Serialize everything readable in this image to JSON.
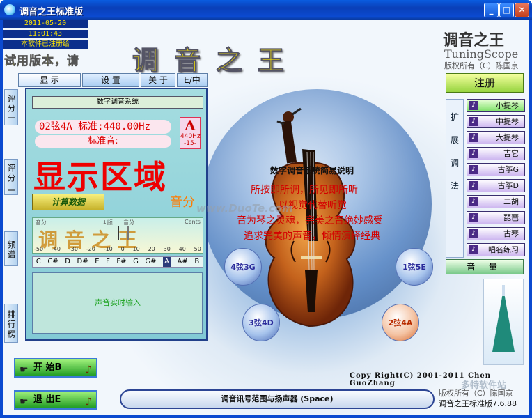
{
  "window": {
    "title": "调音之王标准版",
    "btn_min": "_",
    "btn_max": "□",
    "btn_close": "✕"
  },
  "info": {
    "date": "2011-05-20",
    "time": "11:01:43",
    "registered": "本软件已注册给",
    "trial": "试用版本，请"
  },
  "header": {
    "big_title": "调音之王",
    "logo_cn": "调音之王",
    "logo_en": "TuningScope",
    "logo_copy": "版权所有（C）陈国京"
  },
  "tabs": [
    "显 示",
    "设 置",
    "关 于",
    "E/中"
  ],
  "side_tabs": [
    "评分一",
    "评分二",
    "频谱",
    "排行榜"
  ],
  "panel": {
    "system_name": "数字调音系统",
    "string_info": "02弦4A 标准:440.00Hz",
    "standard_tone": "标准音:",
    "note": "A",
    "note_hz": "440Hz",
    "note_cents": "-15-",
    "display_area": "显示区域",
    "score_label": "音分",
    "calc_button": "计算数据",
    "meter_left": "音分",
    "meter_mid": "↓频",
    "meter_mid2": "音分",
    "meter_right": "Cents",
    "meter_watermark": "调音之王",
    "scale": [
      "-50",
      "-40",
      "-30",
      "-20",
      "-10",
      "0",
      "10",
      "20",
      "30",
      "40",
      "50"
    ],
    "keys": [
      "C",
      "C#",
      "D",
      "D#",
      "E",
      "F",
      "F#",
      "G",
      "G#",
      "A",
      "A#",
      "B"
    ],
    "selected_key": "A",
    "live_input": "声音实时输入"
  },
  "buttons": {
    "start": "开 始B",
    "exit": "退 出E"
  },
  "center": {
    "title": "数字调音系统简易说明",
    "line1": "所按即所调，所见即所听",
    "line2": "以视觉代替听觉",
    "line3": "音为琴之灵魂，完美之音绝妙感受",
    "line4": "追求完美的声音，倾情演绎经典",
    "watermark": "www.DuoTe.com"
  },
  "strings": [
    {
      "label": "4弦3G",
      "active": false
    },
    {
      "label": "1弦5E",
      "active": false
    },
    {
      "label": "3弦4D",
      "active": false
    },
    {
      "label": "2弦4A",
      "active": true
    }
  ],
  "right": {
    "register": "注册",
    "extend_label": [
      "扩",
      "展",
      "调",
      "法"
    ],
    "instruments": [
      "小提琴",
      "中提琴",
      "大提琴",
      "吉它",
      "古筝G",
      "古筝D",
      "二胡",
      "琵琶",
      "古琴",
      "唱名练习"
    ],
    "selected_instrument": "小提琴",
    "volume": "音 量"
  },
  "footer": {
    "copyright": "Copy Right(C) 2001-2011 Chen GuoZhang",
    "status": "调音讯号范围与扬声器 (Space)",
    "copy_cn": "版权所有（C）陈国京",
    "version": "调音之王标准版7.6.88",
    "site_watermark": "多特软件站"
  },
  "colors": {
    "title_blue": "#0a4ad0",
    "accent_red": "#e00000",
    "title_yellow": "#f7e300",
    "green_button": "#1e9a22"
  }
}
